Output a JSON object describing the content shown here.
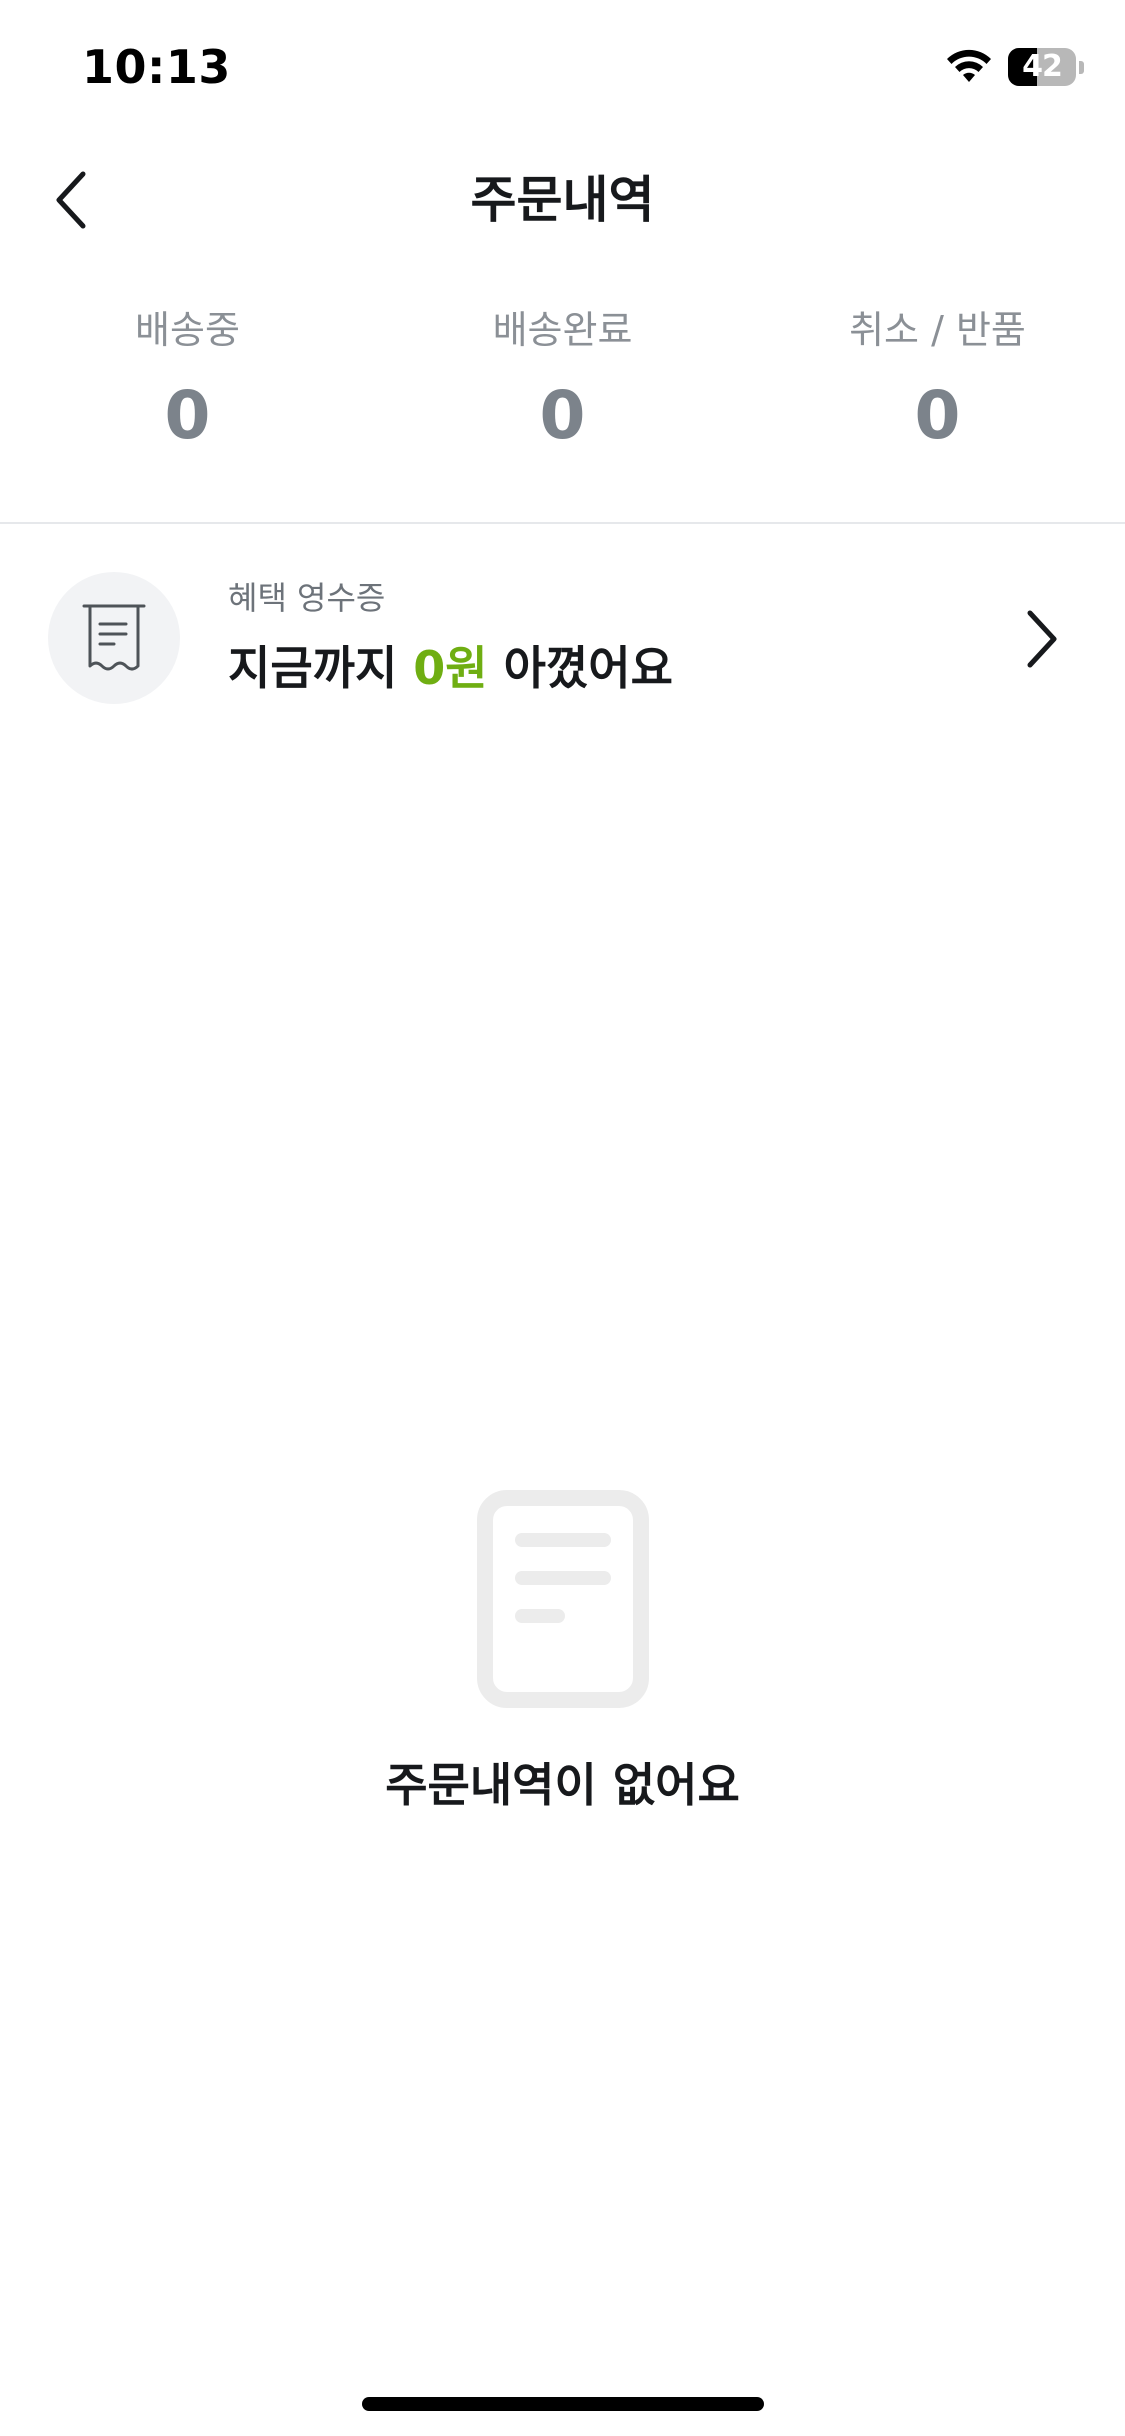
{
  "status_bar": {
    "time": "10:13",
    "battery_level": "42",
    "battery_fraction": 0.42
  },
  "nav": {
    "title": "주문내역",
    "back_icon": "chevron-left-icon"
  },
  "stats": [
    {
      "label": "배송중",
      "value": "0"
    },
    {
      "label": "배송완료",
      "value": "0"
    },
    {
      "label": "취소 / 반품",
      "value": "0"
    }
  ],
  "receipt": {
    "icon": "receipt-icon",
    "caption": "혜택 영수증",
    "headline_prefix": "지금까지",
    "amount": "0원",
    "headline_suffix": "아꼈어요",
    "accent_color": "#6fae12",
    "chevron_icon": "chevron-right-icon"
  },
  "empty_state": {
    "icon": "document-icon",
    "message": "주문내역이 없어요"
  }
}
